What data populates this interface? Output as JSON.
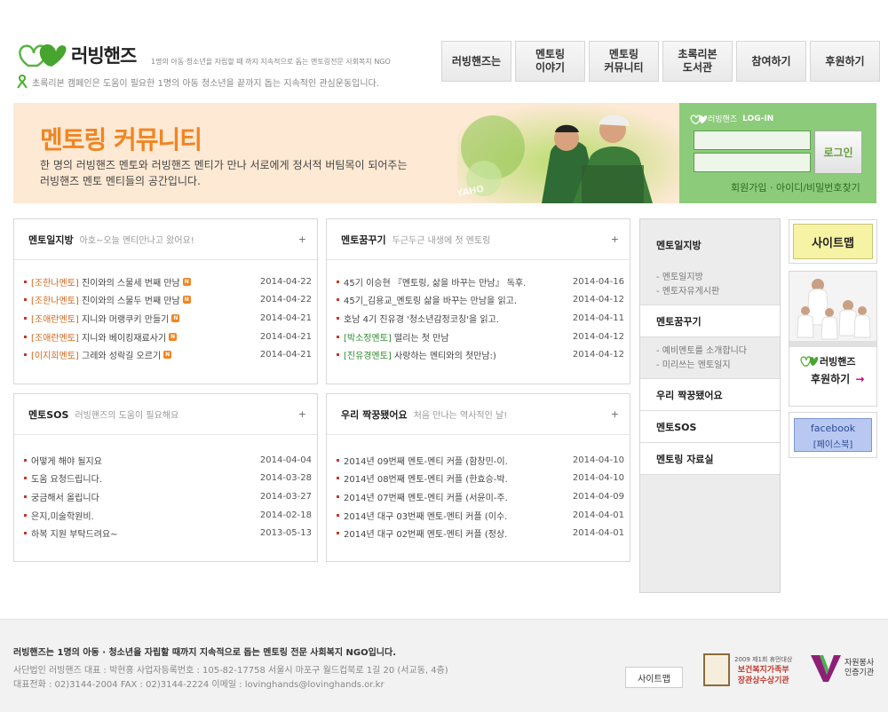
{
  "header": {
    "logo_text": "러빙핸즈",
    "tagline": "1명의 아동·청소년을 자립할 때 까지 지속적으로 돕는 멘토링전문 사회복지 NGO",
    "campaign": "초록리본 캠페인은 도움이 필요한 1명의 아동 청소년을 끝까지 돕는 지속적인 관심운동입니다."
  },
  "gnb": [
    "러빙핸즈는",
    "멘토링\n이야기",
    "멘토링\n커뮤니티",
    "초록리본\n도서관",
    "참여하기",
    "후원하기"
  ],
  "banner": {
    "title": "멘토링 커뮤니티",
    "line1": "한 명의 러빙핸즈 멘토와 러빙핸즈 멘티가 만나 서로에게 정서적 버팀목이 되어주는",
    "line2": "러빙핸즈 멘토 멘티들의 공간입니다."
  },
  "login": {
    "brand": "러빙핸즈",
    "label": "LOG-IN",
    "button": "로그인",
    "links": "회원가입 · 아이디/비밀번호찾기"
  },
  "boards": {
    "diary": {
      "title": "멘토일지방",
      "subtitle": "아호~오늘 멘티만나고 왔어요!",
      "more": "+",
      "rows": [
        {
          "tag": "[조한나멘토]",
          "text": "진이와의 스물세 번째 만남",
          "date": "2014-04-22"
        },
        {
          "tag": "[조한나멘토]",
          "text": "진이와의 스물두 번째 만남",
          "date": "2014-04-22"
        },
        {
          "tag": "[조애란멘토]",
          "text": "지니와 머랭쿠키 만들기",
          "date": "2014-04-21"
        },
        {
          "tag": "[조애란멘토]",
          "text": "지니와 베이킹재료사기",
          "date": "2014-04-21"
        },
        {
          "tag": "[이지희멘토]",
          "text": "그레와 성락길 오르기",
          "date": "2014-04-21"
        }
      ],
      "new_label": "N"
    },
    "dream": {
      "title": "멘토꿈꾸기",
      "subtitle": "두근두근 내생에 첫 멘토링",
      "more": "+",
      "rows": [
        {
          "tag": "",
          "text": "45기 이승현 『멘토링, 삶을 바꾸는 만남』 독후.",
          "date": "2014-04-16"
        },
        {
          "tag": "",
          "text": "45기_김용교_멘토링 삶을 바꾸는 만남을 읽고.",
          "date": "2014-04-12"
        },
        {
          "tag": "",
          "text": "호남 4기 진유경 '청소년감정코칭'을 읽고.",
          "date": "2014-04-11"
        },
        {
          "tag": "[박소정멘토]",
          "text": "떨리는 첫 만남",
          "date": "2014-04-12"
        },
        {
          "tag": "[진유경멘토]",
          "text": "사랑하는 멘티와의 첫만남:)",
          "date": "2014-04-12"
        }
      ]
    },
    "sos": {
      "title": "멘토SOS",
      "subtitle": "러빙핸즈의 도움이 필요해요",
      "more": "+",
      "rows": [
        {
          "text": "어떻게 해야 될지요",
          "date": "2014-04-04"
        },
        {
          "text": "도움 요청드립니다.",
          "date": "2014-03-28"
        },
        {
          "text": "궁금해서 올립니다",
          "date": "2014-03-27"
        },
        {
          "text": " 은지,미술학원비.",
          "date": "2014-02-18"
        },
        {
          "text": "하복 지원 부탁드려요~",
          "date": "2013-05-13"
        }
      ]
    },
    "match": {
      "title": "우리 짝꿍됐어요",
      "subtitle": "처음 만나는 역사적인 날!",
      "more": "+",
      "rows": [
        {
          "text": "2014년 09번째 멘토-멘티 커플 (함창민-이.",
          "date": "2014-04-10"
        },
        {
          "text": "2014년 08번째 멘토-멘티 커플 (한효승-박.",
          "date": "2014-04-10"
        },
        {
          "text": "2014년 07번째 멘토-멘티 커플 (서윤미-주.",
          "date": "2014-04-09"
        },
        {
          "text": "2014년 대구 03번째 멘토-멘티 커플 (이수.",
          "date": "2014-04-01"
        },
        {
          "text": "2014년 대구 02번째 멘토-멘티 커플 (정상.",
          "date": "2014-04-01"
        }
      ]
    }
  },
  "lnb": {
    "diary": "멘토일지방",
    "diary_subs": [
      "- 멘토일지방",
      "- 멘토자유게시판"
    ],
    "dream": "멘토꿈꾸기",
    "dream_subs": [
      "- 예비멘토를 소개합니다",
      "- 미리쓰는 멘토일지"
    ],
    "match": "우리 짝꿍됐어요",
    "sos": "멘토SOS",
    "resources": "멘토링 자료실"
  },
  "right": {
    "sitemap": "사이트맵",
    "donate_brand": "러빙핸즈",
    "donate_cta": "후원하기",
    "donate_arrow": "→",
    "fb_title": "facebook",
    "fb_sub": "[페이스북]"
  },
  "footer": {
    "main": "러빙핸즈는 1명의 아동 · 청소년을 자립할 때까지 지속적으로 돕는 멘토링 전문 사회복지 NGO입니다.",
    "line1": "사단법인 러빙핸즈    대표 : 박현홍    사업자등록번호 : 105-82-17758    서울시 마포구 월드컵북로 1길 20 (서교동, 4층)",
    "line2": "대표전화 : 02)3144-2004    FAX : 02)3144-2224    이메일 : lovinghands@lovinghands.or.kr",
    "sitemap": "사이트맵",
    "award_l1": "2009 제1회 휴먼대상",
    "award_l2": "보건복지가족부",
    "award_l3": "장관상수상기관",
    "vol_l1": "자원봉사",
    "vol_l2": "인증기관"
  },
  "colors": {
    "accent_orange": "#f08522",
    "login_green": "#8bcb7a",
    "banner_bg": "#fde9d4"
  }
}
